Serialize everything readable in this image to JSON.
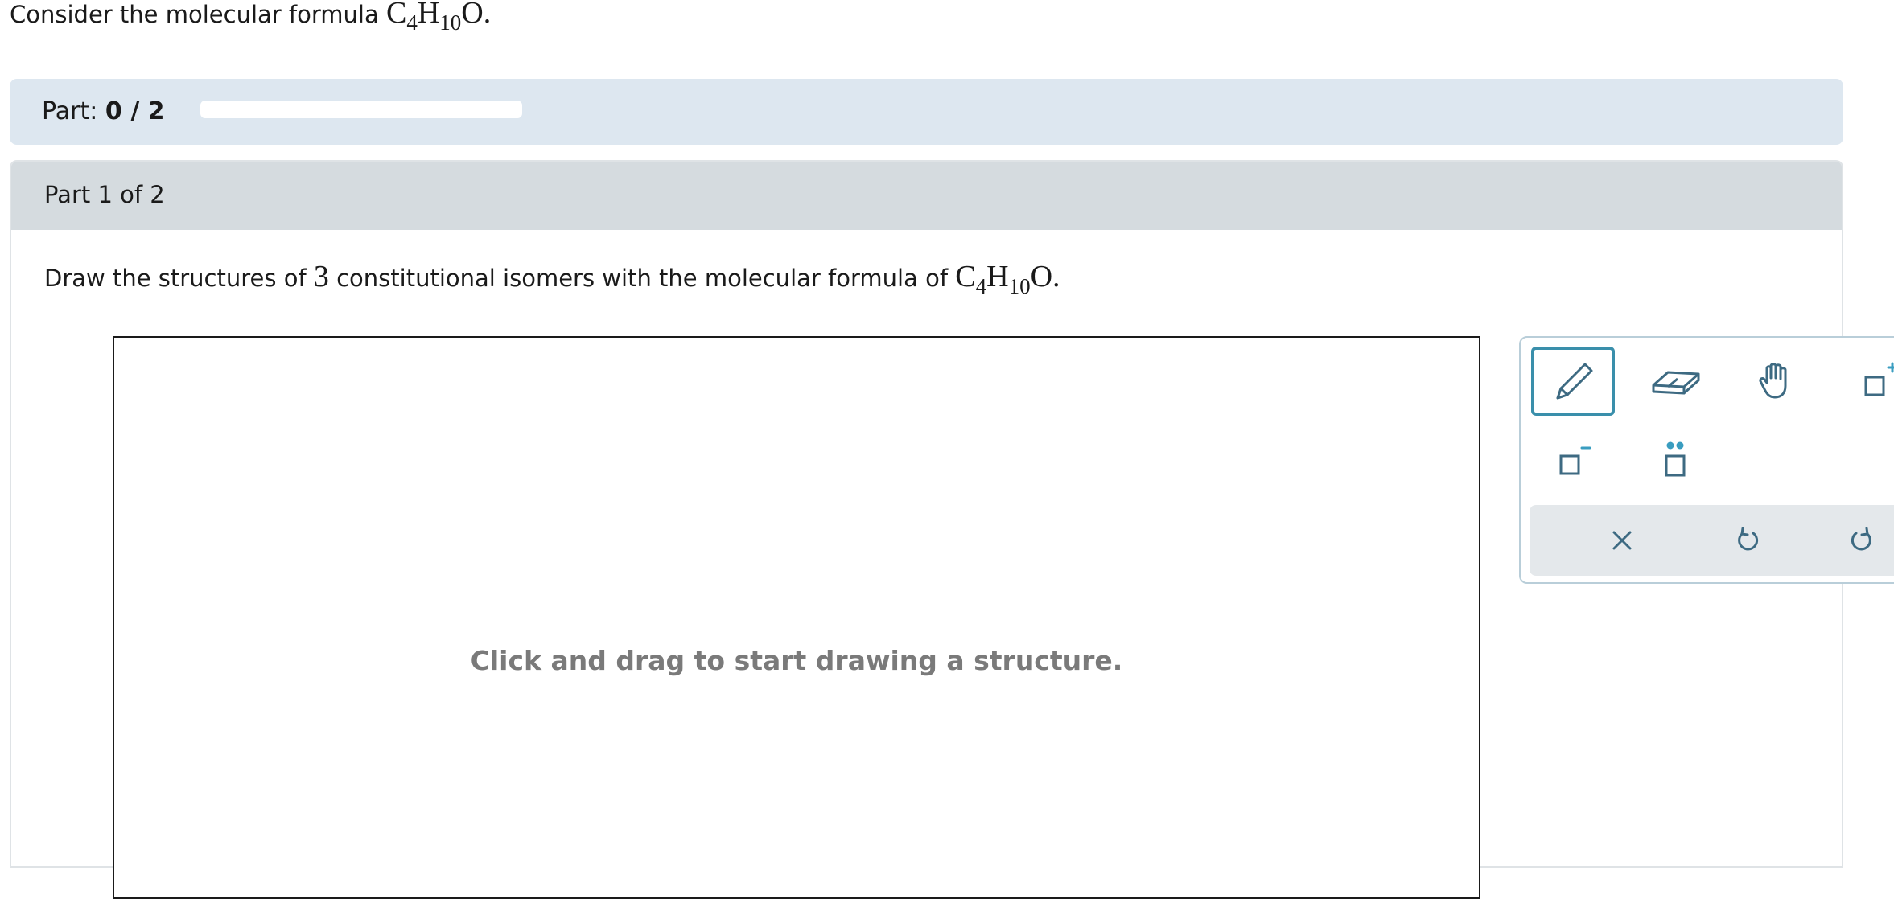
{
  "question": {
    "prefix": "Consider the molecular formula",
    "formula": {
      "c": "C",
      "c_sub": "4",
      "h": "H",
      "h_sub": "10",
      "o": "O",
      "end": "."
    }
  },
  "part_progress": {
    "label": "Part:",
    "value_text": "0 / 2",
    "progress_fraction": 0
  },
  "part": {
    "header": "Part 1 of 2",
    "instructions": {
      "before": "Draw the structures of",
      "count": "3",
      "after": "constitutional isomers with the molecular formula of",
      "formula": {
        "c": "C",
        "c_sub": "4",
        "h": "H",
        "h_sub": "10",
        "o": "O",
        "end": "."
      }
    }
  },
  "canvas": {
    "hint": "Click and drag to start drawing a structure."
  },
  "toolbox": {
    "accent_color": "#3a8fab",
    "tools": [
      {
        "name": "pencil-icon",
        "active": true
      },
      {
        "name": "eraser-icon",
        "active": false
      },
      {
        "name": "hand-icon",
        "active": false
      },
      {
        "name": "positive-charge-icon",
        "active": false
      },
      {
        "name": "negative-charge-icon",
        "active": false
      },
      {
        "name": "lone-pair-icon",
        "active": false
      }
    ],
    "actions": [
      "clear-icon",
      "undo-icon",
      "redo-icon"
    ]
  }
}
